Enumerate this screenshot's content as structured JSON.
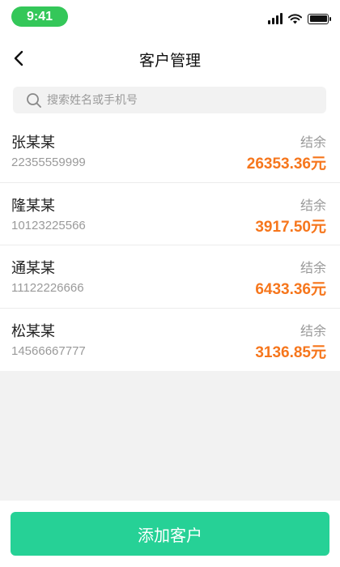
{
  "status_bar": {
    "time": "9:41"
  },
  "nav": {
    "title": "客户管理",
    "back_icon": "chevron-left-icon"
  },
  "search": {
    "placeholder": "搜索姓名或手机号",
    "value": ""
  },
  "customers": [
    {
      "name": "张某某",
      "phone": "22355559999",
      "balance_label": "结余",
      "balance": "26353.36元"
    },
    {
      "name": "隆某某",
      "phone": "10123225566",
      "balance_label": "结余",
      "balance": "3917.50元"
    },
    {
      "name": "通某某",
      "phone": "11122226666",
      "balance_label": "结余",
      "balance": "6433.36元"
    },
    {
      "name": "松某某",
      "phone": "14566667777",
      "balance_label": "结余",
      "balance": "3136.85元"
    }
  ],
  "bottom": {
    "add_label": "添加客户"
  },
  "colors": {
    "accent": "#26d196",
    "amount": "#f6761c",
    "time_pill": "#34c759"
  }
}
